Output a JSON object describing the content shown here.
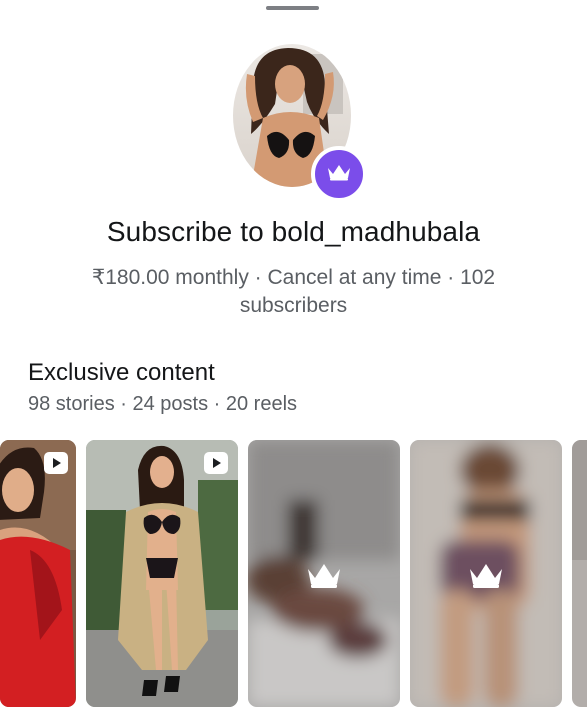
{
  "sheet": {
    "handle": "drag-handle"
  },
  "profile": {
    "username": "bold_madhubala",
    "badge_icon": "crown-icon",
    "badge_color": "#7b4dea"
  },
  "subscribe": {
    "title": "Subscribe to bold_madhubala",
    "subtitle_line1": "₹180.00 monthly · Cancel at any time · 102",
    "subtitle_line2": "subscribers"
  },
  "exclusive": {
    "heading": "Exclusive content",
    "meta": "98 stories · 24 posts · 20 reels"
  },
  "thumbnails": [
    {
      "kind": "reel",
      "locked": false,
      "icon": "play-icon"
    },
    {
      "kind": "reel",
      "locked": false,
      "icon": "play-icon"
    },
    {
      "kind": "blurred",
      "locked": true,
      "icon": "crown-icon"
    },
    {
      "kind": "blurred",
      "locked": true,
      "icon": "crown-icon"
    },
    {
      "kind": "blurred",
      "locked": true,
      "icon": "crown-icon"
    }
  ]
}
